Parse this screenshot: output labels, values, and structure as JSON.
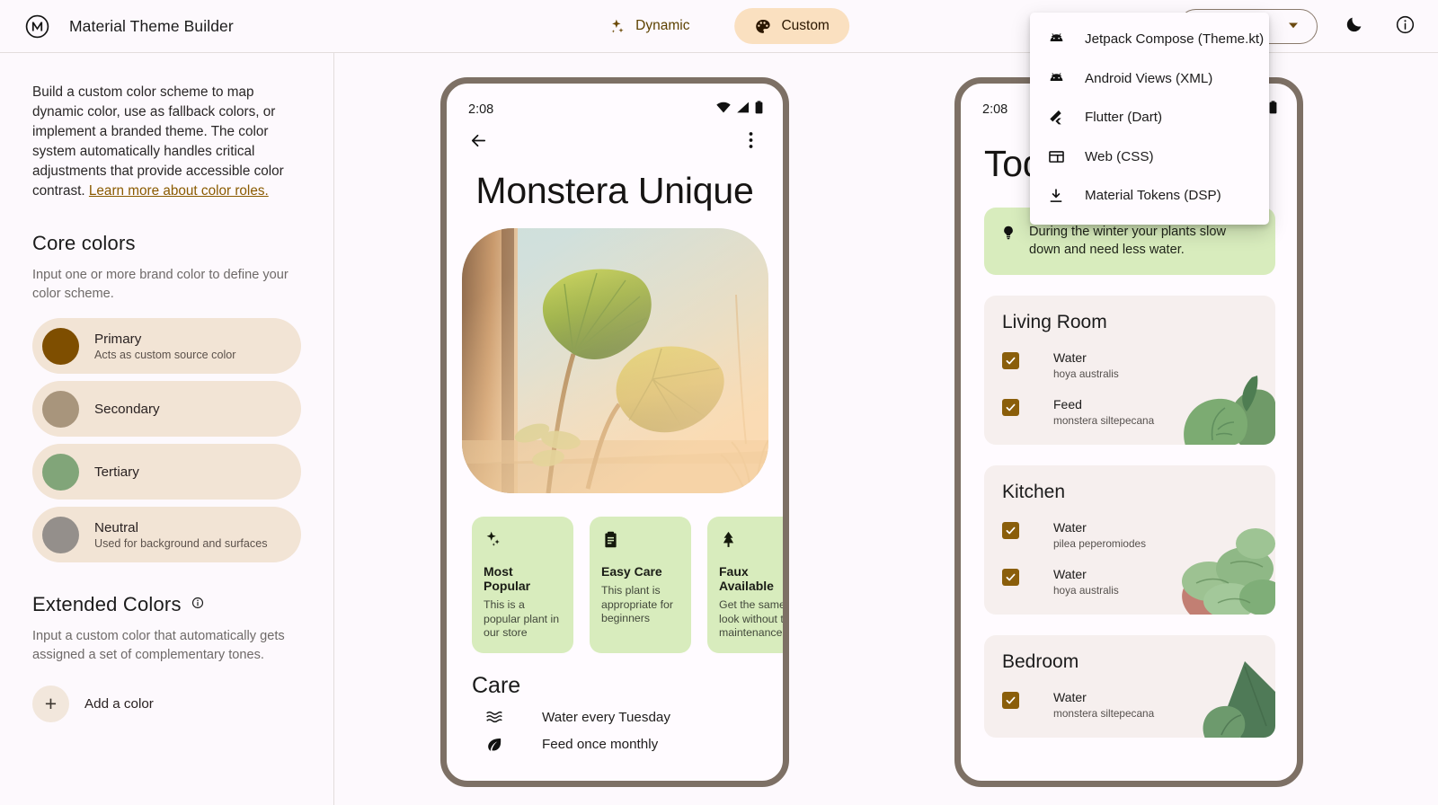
{
  "app": {
    "title": "Material Theme Builder",
    "logo_icon": "material-theme-builder-logo"
  },
  "header": {
    "segments": [
      {
        "label": "Dynamic",
        "icon": "sparkle-icon",
        "active": false
      },
      {
        "label": "Custom",
        "icon": "palette-icon",
        "active": true
      }
    ],
    "export_button": {
      "label": "",
      "icon": "chevron-down-icon"
    },
    "dark_mode_icon": "moon-icon",
    "info_icon": "info-icon"
  },
  "export_menu": {
    "items": [
      {
        "label": "Jetpack Compose (Theme.kt)",
        "icon": "android-icon"
      },
      {
        "label": "Android Views (XML)",
        "icon": "android-icon"
      },
      {
        "label": "Flutter (Dart)",
        "icon": "flutter-icon"
      },
      {
        "label": "Web (CSS)",
        "icon": "web-css-icon"
      },
      {
        "label": "Material Tokens (DSP)",
        "icon": "download-icon"
      }
    ]
  },
  "sidebar": {
    "intro_text": "Build a custom color scheme to map dynamic color, use as fallback colors, or implement a branded theme. The color system automatically handles critical adjustments that provide accessible color contrast. ",
    "intro_link": "Learn more about color roles.",
    "core_colors_heading": "Core colors",
    "core_colors_sub": "Input one or more brand color to define your color scheme.",
    "swatches": [
      {
        "name": "Primary",
        "desc": "Acts as custom source color",
        "color": "#7e4e00"
      },
      {
        "name": "Secondary",
        "desc": "",
        "color": "#a8957c"
      },
      {
        "name": "Tertiary",
        "desc": "",
        "color": "#81a579"
      },
      {
        "name": "Neutral",
        "desc": "Used for background and surfaces",
        "color": "#948f8b"
      }
    ],
    "extended_heading": "Extended Colors",
    "extended_info_icon": "info-icon",
    "extended_sub": "Input a custom color that automatically gets assigned a set of complementary tones.",
    "add_color_label": "Add a color",
    "add_color_icon": "plus-icon"
  },
  "phone1": {
    "status_time": "2:08",
    "status_icons": [
      "wifi-icon",
      "signal-icon",
      "battery-icon"
    ],
    "back_icon": "back-arrow-icon",
    "overflow_icon": "more-vert-icon",
    "title": "Monstera Unique",
    "hero_image_alt": "monstera plant on windowsill",
    "chips": [
      {
        "icon": "sparkle-icon",
        "title": "Most Popular",
        "desc": "This is a popular plant in our store"
      },
      {
        "icon": "clipboard-icon",
        "title": "Easy Care",
        "desc": "This plant is appropriate for beginners"
      },
      {
        "icon": "tree-icon",
        "title": "Faux Available",
        "desc": "Get the same look without the maintenance"
      }
    ],
    "care_heading": "Care",
    "care_items": [
      {
        "icon": "water-waves-icon",
        "text": "Water every Tuesday"
      },
      {
        "icon": "leaf-icon",
        "text": "Feed once monthly"
      }
    ]
  },
  "phone2": {
    "status_time": "2:08",
    "status_icons": [
      "battery-icon"
    ],
    "title": "Today",
    "tip": {
      "icon": "lightbulb-icon",
      "text": "During the winter your plants slow down and need less water."
    },
    "rooms": [
      {
        "name": "Living Room",
        "tasks": [
          {
            "name": "Water",
            "sub": "hoya australis",
            "checked": true
          },
          {
            "name": "Feed",
            "sub": "monstera siltepecana",
            "checked": true
          }
        ]
      },
      {
        "name": "Kitchen",
        "tasks": [
          {
            "name": "Water",
            "sub": "pilea peperomiodes",
            "checked": true
          },
          {
            "name": "Water",
            "sub": "hoya australis",
            "checked": true
          }
        ]
      },
      {
        "name": "Bedroom",
        "tasks": [
          {
            "name": "Water",
            "sub": "monstera siltepecana",
            "checked": true
          }
        ]
      }
    ]
  },
  "colors": {
    "primary": "#7e4e00",
    "accent_container": "#fae0c0",
    "green_container": "#d8ecbd",
    "surface": "#fdf9fd",
    "phone_frame": "#7d7065",
    "card_surface": "#f6efee",
    "checkbox": "#8a5e0a"
  }
}
